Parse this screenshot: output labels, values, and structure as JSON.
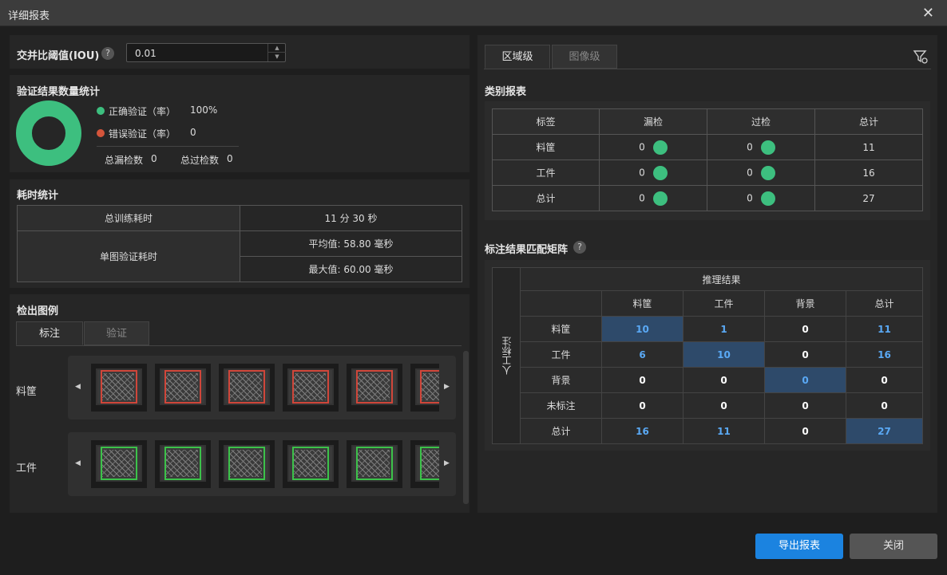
{
  "window": {
    "title": "详细报表",
    "close_glyph": "✕"
  },
  "iou": {
    "label": "交并比阈值(IOU)",
    "help": "?",
    "value": "0.01",
    "up": "▲",
    "down": "▼"
  },
  "validation": {
    "title": "验证结果数量统计",
    "correct_label": "正确验证（率）",
    "correct_value": "100%",
    "correct_color": "#3dbf7f",
    "error_label": "错误验证（率）",
    "error_value": "0",
    "error_color": "#d4553b",
    "missed_label": "总漏检数",
    "missed_value": "0",
    "over_label": "总过检数",
    "over_value": "0"
  },
  "timing": {
    "title": "耗时统计",
    "train_label": "总训练耗时",
    "train_value": "11 分 30 秒",
    "single_label": "单图验证耗时",
    "avg": "平均值: 58.80 毫秒",
    "max": "最大值: 60.00 毫秒"
  },
  "legend": {
    "title": "检出图例",
    "tabs": [
      "标注",
      "验证"
    ],
    "rows": [
      {
        "label": "料筐",
        "color": "#d0463a"
      },
      {
        "label": "工件",
        "color": "#3cc24a"
      }
    ],
    "prev": "◀",
    "next": "▶"
  },
  "right_tabs": [
    "区域级",
    "图像级"
  ],
  "category": {
    "title": "类别报表",
    "headers": [
      "标签",
      "漏检",
      "过检",
      "总计"
    ],
    "rows": [
      {
        "label": "料筐",
        "miss": "0",
        "over": "0",
        "total": "11"
      },
      {
        "label": "工件",
        "miss": "0",
        "over": "0",
        "total": "16"
      },
      {
        "label": "总计",
        "miss": "0",
        "over": "0",
        "total": "27"
      }
    ],
    "dot_color": "#3dbf7f"
  },
  "matrix": {
    "title": "标注结果匹配矩阵",
    "help": "?",
    "top_header": "推理结果",
    "side_header": "人工标注",
    "cols": [
      "料筐",
      "工件",
      "背景",
      "总计"
    ],
    "rows": [
      {
        "label": "料筐",
        "values": [
          "10",
          "1",
          "0",
          "11"
        ]
      },
      {
        "label": "工件",
        "values": [
          "6",
          "10",
          "0",
          "16"
        ]
      },
      {
        "label": "背景",
        "values": [
          "0",
          "0",
          "0",
          "0"
        ]
      },
      {
        "label": "未标注",
        "values": [
          "0",
          "0",
          "0",
          "0"
        ]
      },
      {
        "label": "总计",
        "values": [
          "16",
          "11",
          "0",
          "27"
        ]
      }
    ]
  },
  "buttons": {
    "export": "导出报表",
    "close": "关闭"
  },
  "icons": {
    "filter": "filter-icon"
  }
}
